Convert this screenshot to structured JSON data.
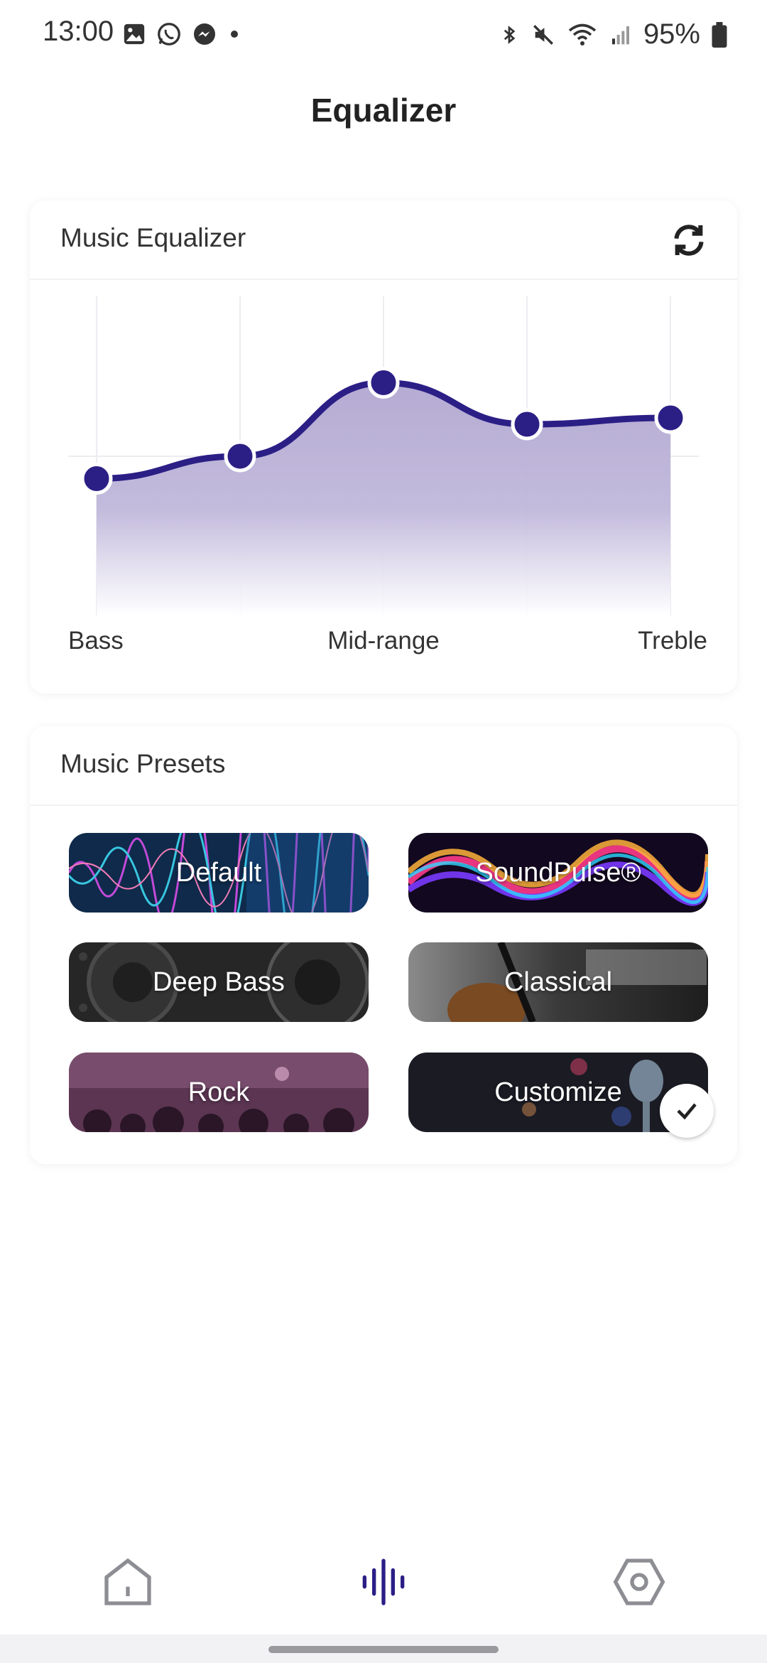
{
  "status_bar": {
    "time": "13:00",
    "battery_percent": "95%",
    "left_icons": [
      "gallery-icon",
      "whatsapp-icon",
      "messenger-icon",
      "dot-icon"
    ],
    "right_icons": [
      "bluetooth-icon",
      "mute-icon",
      "wifi-icon",
      "signal-icon",
      "battery-icon"
    ]
  },
  "header": {
    "title": "Equalizer"
  },
  "equalizer_card": {
    "title": "Music Equalizer",
    "reset_icon": "refresh-icon",
    "band_labels": [
      "Bass",
      "Mid-range",
      "Treble"
    ],
    "bands": [
      {
        "level": 0.43
      },
      {
        "level": 0.5
      },
      {
        "level": 0.73
      },
      {
        "level": 0.6
      },
      {
        "level": 0.62
      }
    ],
    "accent_color": "#2b1f86",
    "fill_color": "#b9b0d6"
  },
  "presets_card": {
    "title": "Music Presets",
    "presets": [
      {
        "label": "Default",
        "selected": false
      },
      {
        "label": "SoundPulse®",
        "selected": false
      },
      {
        "label": "Deep Bass",
        "selected": false
      },
      {
        "label": "Classical",
        "selected": false
      },
      {
        "label": "Rock",
        "selected": false
      },
      {
        "label": "Customize",
        "selected": true
      }
    ]
  },
  "bottom_nav": {
    "items": [
      {
        "icon": "home-icon",
        "active": false
      },
      {
        "icon": "equalizer-icon",
        "active": true
      },
      {
        "icon": "settings-icon",
        "active": false
      }
    ],
    "active_color": "#2b1f86",
    "inactive_color": "#8d8d94"
  }
}
